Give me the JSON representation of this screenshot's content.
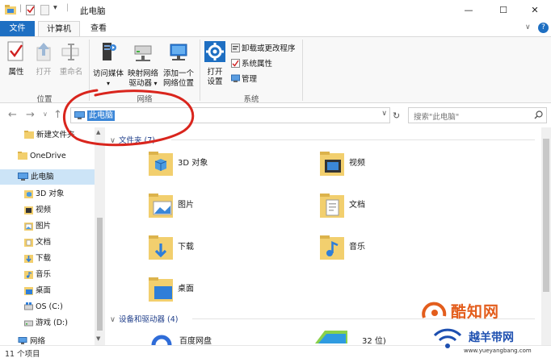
{
  "window": {
    "title": "此电脑",
    "controls": {
      "minimize": "—",
      "maximize": "☐",
      "close": "✕"
    },
    "help": "?"
  },
  "ribbon_tabs": {
    "file": "文件",
    "computer": "计算机",
    "view": "查看",
    "collapse": "∨"
  },
  "ribbon": {
    "location_group": {
      "label": "位置",
      "properties": "属性",
      "open": "打开",
      "rename": "重命名"
    },
    "network_group": {
      "label": "网络",
      "media_line1": "访问媒体",
      "map_line1": "映射网络",
      "map_line2": "驱动器",
      "add_line1": "添加一个",
      "add_line2": "网络位置"
    },
    "system_group": {
      "label": "系统",
      "settings_line1": "打开",
      "settings_line2": "设置",
      "uninstall": "卸载或更改程序",
      "sys_props": "系统属性",
      "manage": "管理"
    }
  },
  "address": {
    "back": "←",
    "forward": "→",
    "recent": "∨",
    "up": "↑",
    "path": "此电脑",
    "refresh": "↻",
    "search_placeholder": "搜索\"此电脑\""
  },
  "nav": {
    "items": [
      {
        "label": "新建文件夹"
      },
      {
        "label": "OneDrive"
      },
      {
        "label": "此电脑"
      },
      {
        "label": "3D 对象"
      },
      {
        "label": "视频"
      },
      {
        "label": "图片"
      },
      {
        "label": "文档"
      },
      {
        "label": "下载"
      },
      {
        "label": "音乐"
      },
      {
        "label": "桌面"
      },
      {
        "label": "OS (C:)"
      },
      {
        "label": "游戏 (D:)"
      },
      {
        "label": "网络"
      }
    ]
  },
  "content": {
    "folders_header": "文件夹 (7)",
    "folders": [
      {
        "label": "3D 对象"
      },
      {
        "label": "视频"
      },
      {
        "label": "图片"
      },
      {
        "label": "文档"
      },
      {
        "label": "下载"
      },
      {
        "label": "音乐"
      },
      {
        "label": "桌面"
      }
    ],
    "devices_header": "设备和驱动器 (4)",
    "devices": [
      {
        "label": "百度网盘"
      },
      {
        "label": "32 位)"
      }
    ]
  },
  "status": {
    "count": "11 个项目"
  },
  "watermark": {
    "main": "酷知网",
    "sub": "越羊带网",
    "url": "www.yueyangbang.com"
  },
  "colors": {
    "accent": "#1e6fc2",
    "selection": "#3b87d8",
    "nav_selected": "#cce4f7",
    "folder": "#f2cf6e",
    "annotation": "#d9251d"
  }
}
